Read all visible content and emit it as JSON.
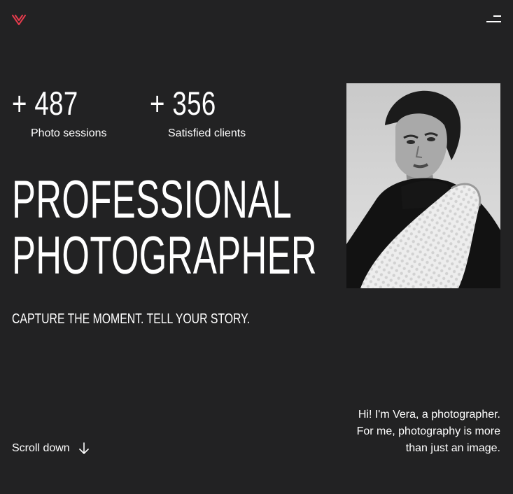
{
  "logo": {
    "icon": "heart-v-logo",
    "color": "#e33b4c"
  },
  "nav": {
    "menu_icon": "hamburger-menu-icon"
  },
  "stats": [
    {
      "value": "+ 487",
      "label": "Photo sessions"
    },
    {
      "value": "+ 356",
      "label": "Satisfied clients"
    }
  ],
  "hero": {
    "headline_line1": "PROFESSIONAL",
    "headline_line2": "PHOTOGRAPHER",
    "tagline": "CAPTURE THE MOMENT. TELL YOUR STORY."
  },
  "scroll": {
    "label": "Scroll down",
    "icon": "arrow-down-icon"
  },
  "intro": {
    "line1": "Hi! I'm Vera, a photographer.",
    "line2": "For me, photography is more",
    "line3": "than just an image."
  }
}
